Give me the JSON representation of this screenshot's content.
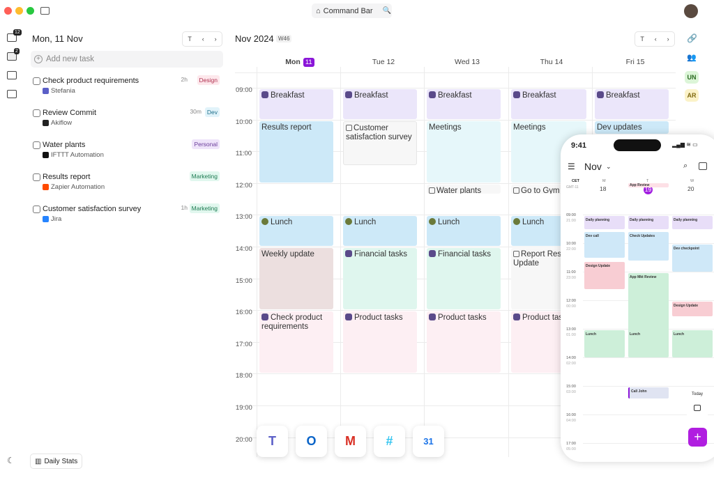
{
  "window": {
    "command_bar": "Command Bar"
  },
  "sidebar": {
    "inbox_badge": "12",
    "calendar_badge": "2",
    "calendar_num": "31",
    "cal2_num": "31"
  },
  "tasks_panel": {
    "date": "Mon, 11 Nov",
    "today_btn": "T",
    "add_placeholder": "Add new task",
    "stats": "Daily Stats"
  },
  "tasks": [
    {
      "title": "Check product requirements",
      "source": "Stefania",
      "duration": "2h",
      "tag": "Design",
      "tag_bg": "#fde8ec",
      "tag_fg": "#b03050",
      "icon_color": "#5b5fc7"
    },
    {
      "title": "Review Commit",
      "source": "Akiflow",
      "duration": "30m",
      "tag": "Dev",
      "tag_bg": "#e1f3fa",
      "tag_fg": "#1f6f8b",
      "icon_color": "#222"
    },
    {
      "title": "Water plants",
      "source": "IFTTT Automation",
      "duration": "",
      "tag": "Personal",
      "tag_bg": "#efe4fa",
      "tag_fg": "#6a3d9a",
      "icon_color": "#111"
    },
    {
      "title": "Results report",
      "source": "Zapier Automation",
      "duration": "",
      "tag": "Marketing",
      "tag_bg": "#e1f7ee",
      "tag_fg": "#1b7a50",
      "icon_color": "#ff4a00"
    },
    {
      "title": "Customer satisfaction survey",
      "source": "Jira",
      "duration": "1h",
      "tag": "Marketing",
      "tag_bg": "#e1f7ee",
      "tag_fg": "#1b7a50",
      "icon_color": "#2684ff"
    }
  ],
  "calendar": {
    "month": "Nov 2024",
    "week": "W46",
    "today_btn": "T",
    "days": [
      {
        "name": "Mon",
        "num": "11"
      },
      {
        "name": "Tue 12"
      },
      {
        "name": "Wed 13"
      },
      {
        "name": "Thu 14"
      },
      {
        "name": "Fri 15"
      }
    ],
    "times": [
      "09:00",
      "10:00",
      "11:00",
      "12:00",
      "13:00",
      "14:00",
      "15:00",
      "16:00",
      "17:00",
      "18:00",
      "19:00",
      "20:00"
    ]
  },
  "events": {
    "breakfast": "Breakfast",
    "results": "Results report",
    "survey": "Customer satisfaction survey",
    "meetings": "Meetings",
    "dev_updates": "Dev updates",
    "water": "Water plants",
    "gym": "Go to Gym",
    "lunch": "Lunch",
    "weekly": "Weekly update",
    "financial": "Financial tasks",
    "report_res": "Report Res Update",
    "check": "Check product requirements",
    "product": "Product tasks"
  },
  "right_rail": {
    "un": "UN",
    "ar": "AR"
  },
  "dock": [
    "Teams",
    "Outlook",
    "Gmail",
    "Slack",
    "Google Calendar"
  ],
  "phone": {
    "time": "9:41",
    "month": "Nov",
    "tz1": "CET",
    "tz2": "GMT-11",
    "days": [
      {
        "l": "M",
        "n": "18"
      },
      {
        "l": "T",
        "n": "19"
      },
      {
        "l": "W",
        "n": "20"
      }
    ],
    "times": [
      [
        "09:00",
        "21:00"
      ],
      [
        "10:00",
        "22:00"
      ],
      [
        "11:00",
        "23:00"
      ],
      [
        "12:00",
        "00:00"
      ],
      [
        "13:00",
        "01:00"
      ],
      [
        "14:00",
        "02:00"
      ],
      [
        "15:00",
        "03:00"
      ],
      [
        "16:00",
        "04:00"
      ],
      [
        "17:00",
        "05:00"
      ]
    ],
    "events": {
      "app_mkt": "App Mkt Review",
      "app_review": "App Review",
      "daily": "Daily planning",
      "dev_call": "Dev call",
      "check_updates": "Check Updates",
      "dev_checkpoint": "Dev checkpoint",
      "design_update": "Design Update",
      "lunch": "Lunch",
      "call_john": "Call John"
    },
    "today": "Today"
  }
}
